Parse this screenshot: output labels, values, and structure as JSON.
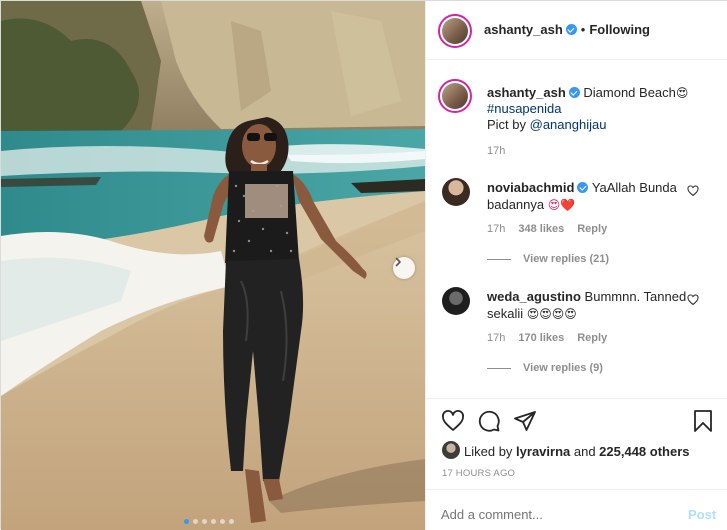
{
  "post": {
    "author": "ashanty_ash",
    "follow_state": "Following",
    "separator": "•",
    "caption": {
      "author": "ashanty_ash",
      "text": "Diamond Beach",
      "text_emoji": "😍",
      "hashtag": "#nusapenida",
      "credit_prefix": "Pict by ",
      "credit_mention": "@ananghijau",
      "time": "17h"
    },
    "comments": [
      {
        "user": "noviabachmid",
        "verified": true,
        "text_line1": "YaAllah Bunda",
        "text_line2": "badannya",
        "emoji": "😍❤️",
        "time": "17h",
        "likes": "348 likes",
        "reply_label": "Reply",
        "view_replies": "View replies (21)"
      },
      {
        "user": "weda_agustino",
        "verified": false,
        "text_line1": "Bummnn. Tanned",
        "text_line2": "sekalii",
        "emoji": "😍😍😍😍",
        "time": "17h",
        "likes": "170 likes",
        "reply_label": "Reply",
        "view_replies": "View replies (9)"
      }
    ],
    "liked_by": {
      "prefix": "Liked by ",
      "user": "lyravirna",
      "middle": " and ",
      "others": "225,448 others"
    },
    "time_ago": "17 HOURS AGO",
    "add_comment_placeholder": "Add a comment...",
    "post_button": "Post",
    "carousel": {
      "count": 6,
      "active_index": 0
    }
  },
  "icons": {
    "verified": "verified-badge-icon",
    "next": "chevron-right-icon",
    "like": "heart-icon",
    "comment": "comment-icon",
    "share": "paper-plane-icon",
    "save": "bookmark-icon"
  },
  "colors": {
    "link": "#00376b",
    "verified": "#3897f0",
    "muted": "#8e8e8e",
    "post_disabled": "#b2dffc",
    "story_ring": "#d6249f"
  }
}
